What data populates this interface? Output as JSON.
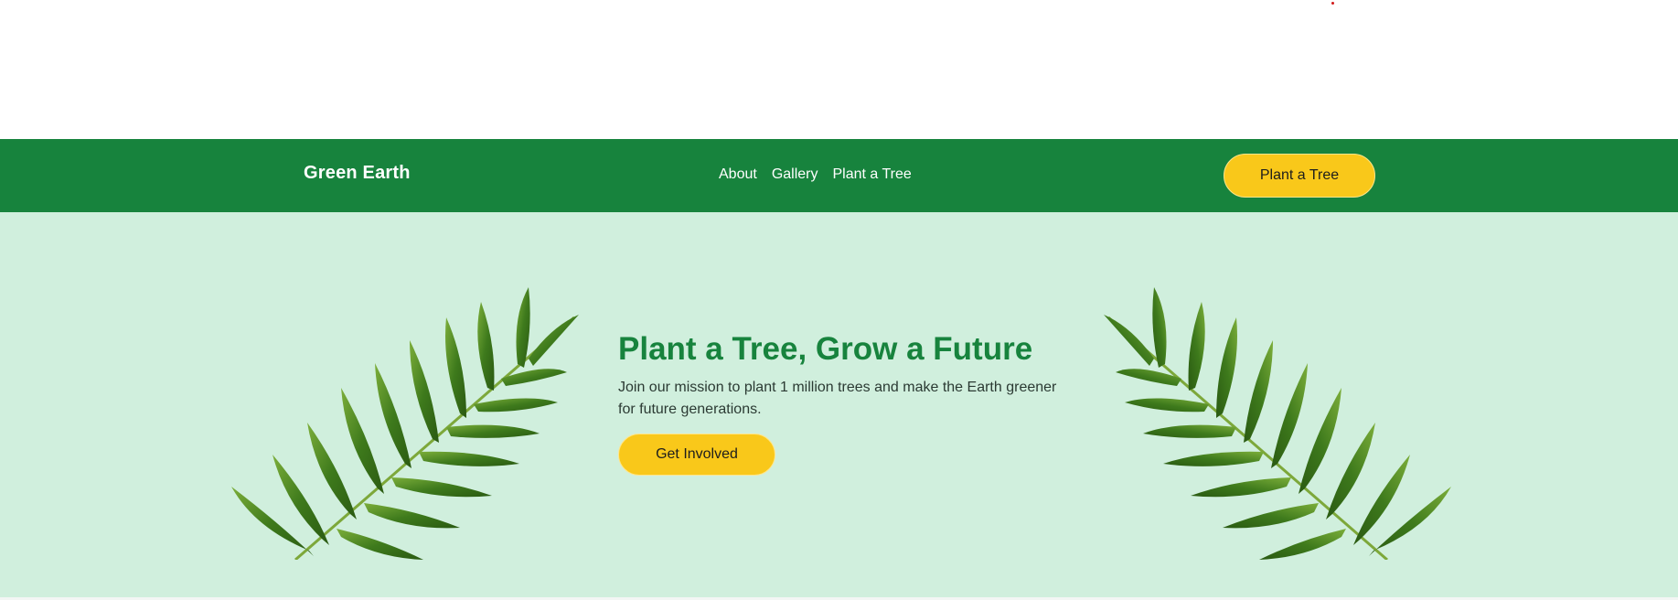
{
  "navbar": {
    "brand": "Green Earth",
    "links": [
      {
        "label": "About"
      },
      {
        "label": "Gallery"
      },
      {
        "label": "Plant a Tree"
      }
    ],
    "cta_label": "Plant a Tree"
  },
  "hero": {
    "title": "Plant a Tree, Grow a Future",
    "subtitle": "Join our mission to plant 1 million trees and make the Earth greener for future generations.",
    "cta_label": "Get Involved"
  },
  "colors": {
    "nav_background": "#17833d",
    "hero_background": "#d0efdd",
    "accent_yellow": "#f9c81a",
    "title_green": "#17833d"
  },
  "icons": {
    "left_leaf": "palm-leaf-icon",
    "right_leaf": "palm-leaf-icon"
  }
}
